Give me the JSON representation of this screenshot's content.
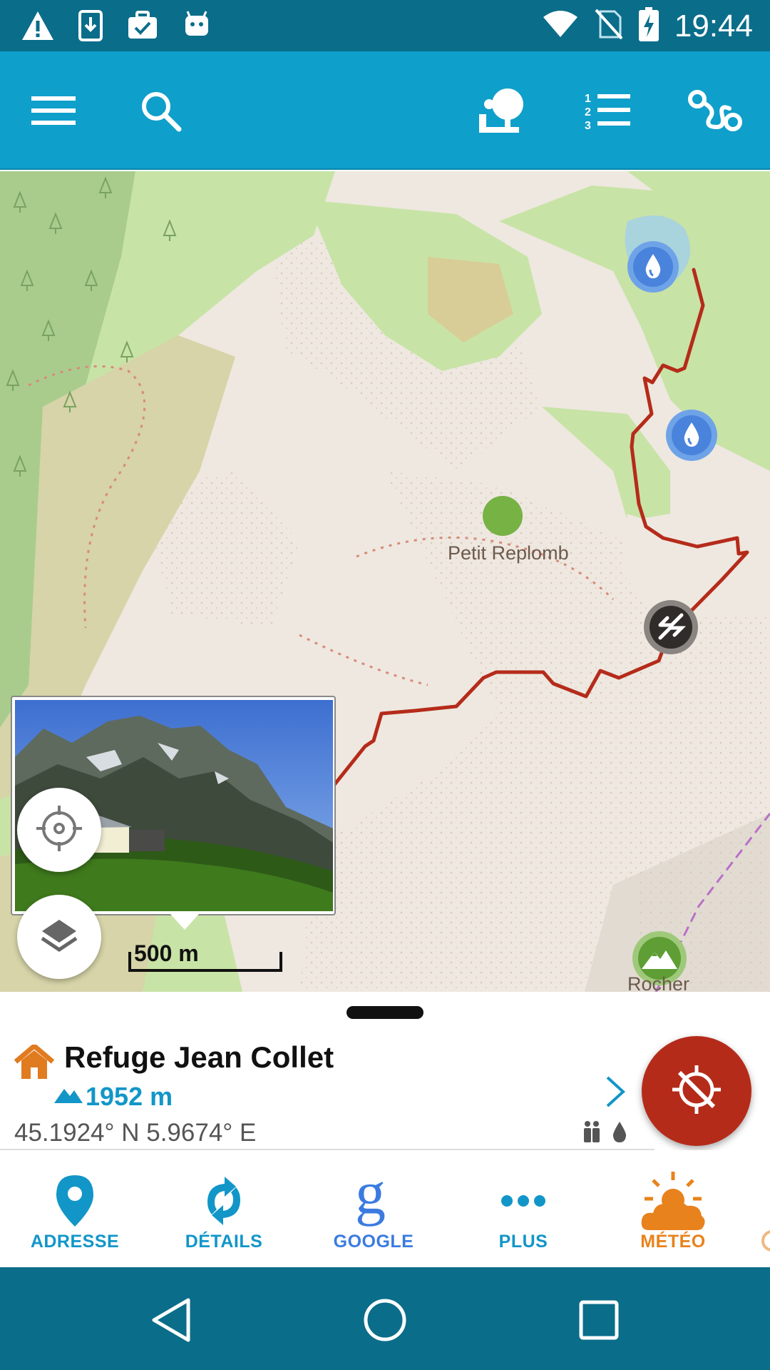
{
  "status_bar": {
    "time": "19:44",
    "left_icons": [
      "warning-icon",
      "download-icon",
      "briefcase-check-icon",
      "android-icon"
    ],
    "right_icons": [
      "wifi-icon",
      "no-sim-icon",
      "battery-charging-icon"
    ]
  },
  "toolbar": {
    "buttons": [
      "menu-icon",
      "search-icon",
      "poi-tree-icon",
      "numbered-list-icon",
      "route-icon"
    ]
  },
  "map": {
    "place_labels": [
      "Petit Replomb",
      "Rocher"
    ],
    "scale_label": "500 m",
    "markers": [
      "water-icon",
      "water-icon",
      "pass-icon",
      "refuge-icon",
      "refuge-icon",
      "summit-icon"
    ]
  },
  "poi": {
    "name": "Refuge Jean Collet",
    "elevation": "1952 m",
    "coordinates": "45.1924° N 5.9674° E"
  },
  "actions": [
    {
      "label": "ADRESSE",
      "icon": "map-pin-icon",
      "color": "#1296c8"
    },
    {
      "label": "DÉTAILS",
      "icon": "refresh-icon",
      "color": "#1296c8"
    },
    {
      "label": "GOOGLE",
      "icon": "google-icon",
      "color": "#3b7be0"
    },
    {
      "label": "PLUS",
      "icon": "more-dots-icon",
      "color": "#1296c8"
    },
    {
      "label": "MÉTÉO",
      "icon": "weather-icon",
      "color": "#e8821c"
    }
  ],
  "colors": {
    "primary": "#0f9fcb",
    "status_bar": "#0a6d8a",
    "route": "#b52b1a",
    "refuge": "#e07b1f"
  }
}
